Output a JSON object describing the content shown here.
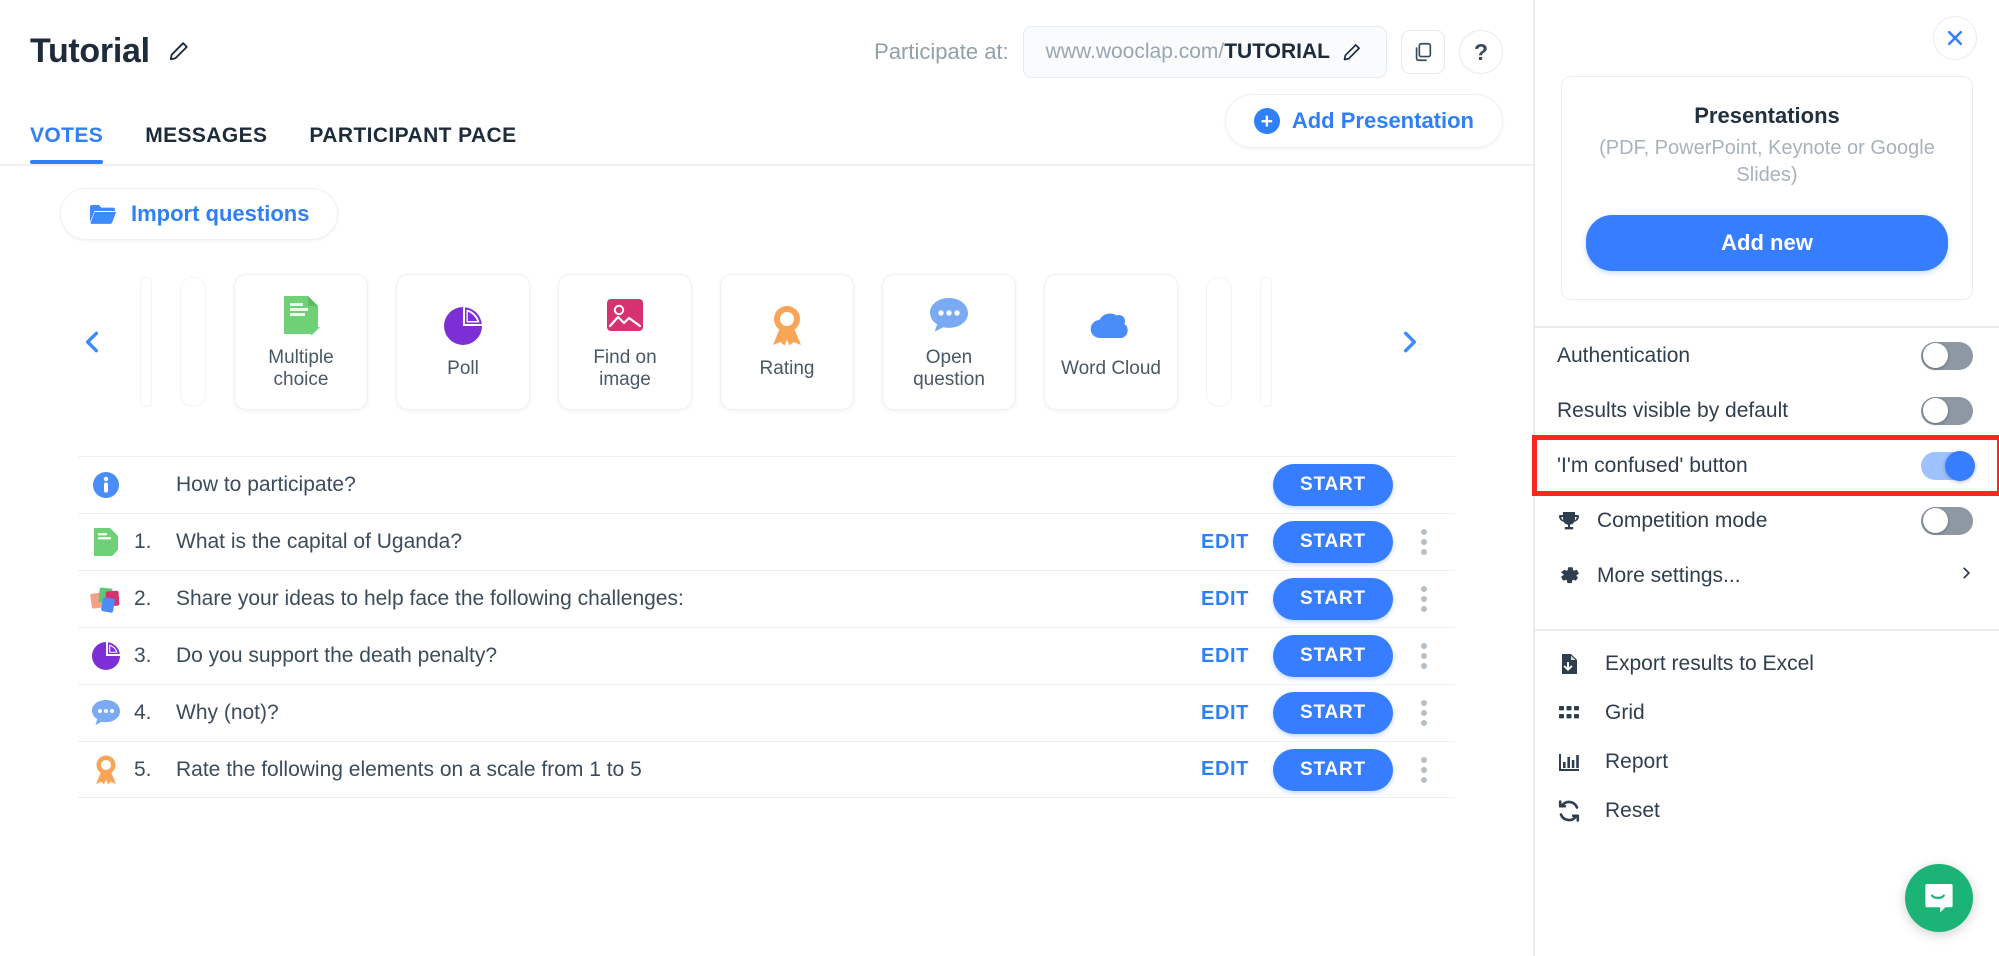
{
  "header": {
    "project_title": "Tutorial",
    "edit_title_icon": "pencil-icon",
    "participate_label": "Participate at:",
    "url_prefix": "www.wooclap.com/",
    "url_code": "TUTORIAL",
    "copy_icon": "copy-icon",
    "help_label": "?",
    "tabs": [
      {
        "label": "VOTES",
        "active": true
      },
      {
        "label": "MESSAGES",
        "active": false
      },
      {
        "label": "PARTICIPANT PACE",
        "active": false
      }
    ],
    "add_presentation_label": "Add Presentation"
  },
  "toolbar": {
    "import_questions_label": "Import questions",
    "prev_arrow_icon": "chevron-left-icon",
    "next_arrow_icon": "chevron-right-icon"
  },
  "question_types": [
    {
      "label": "Multiple choice",
      "icon": "multiple-choice-icon",
      "color": "#6fd176"
    },
    {
      "label": "Poll",
      "icon": "poll-pie-icon",
      "color": "#7b2fd4"
    },
    {
      "label": "Find on image",
      "icon": "find-on-image-icon",
      "color": "#d6326f"
    },
    {
      "label": "Rating",
      "icon": "rating-ribbon-icon",
      "color": "#f6a martin"
    },
    {
      "label": "Open question",
      "icon": "open-question-icon",
      "color": "#6fa8f5"
    },
    {
      "label": "Word Cloud",
      "icon": "word-cloud-icon",
      "color": "#4b8df8"
    }
  ],
  "questions": [
    {
      "num": "",
      "text": "How to participate?",
      "icon": "info-icon",
      "edit": "",
      "start": "START",
      "has_menu": false
    },
    {
      "num": "1.",
      "text": "What is the capital of Uganda?",
      "icon": "multiple-choice-icon",
      "edit": "EDIT",
      "start": "START",
      "has_menu": true
    },
    {
      "num": "2.",
      "text": "Share your ideas to help face the following challenges:",
      "icon": "brainstorm-icon",
      "edit": "EDIT",
      "start": "START",
      "has_menu": true
    },
    {
      "num": "3.",
      "text": "Do you support the death penalty?",
      "icon": "poll-pie-icon",
      "edit": "EDIT",
      "start": "START",
      "has_menu": true
    },
    {
      "num": "4.",
      "text": "Why (not)?",
      "icon": "open-question-icon",
      "edit": "EDIT",
      "start": "START",
      "has_menu": true
    },
    {
      "num": "5.",
      "text": "Rate the following elements on a scale from 1 to 5",
      "icon": "rating-ribbon-icon",
      "edit": "EDIT",
      "start": "START",
      "has_menu": true
    }
  ],
  "sidebar": {
    "close_icon": "close-icon",
    "presentations": {
      "title": "Presentations",
      "subtitle": "(PDF, PowerPoint, Keynote or Google Slides)",
      "add_new_label": "Add new"
    },
    "settings": [
      {
        "label": "Authentication",
        "state": "off",
        "icon": "",
        "highlighted": false
      },
      {
        "label": "Results visible by default",
        "state": "off",
        "icon": "",
        "highlighted": false
      },
      {
        "label": "'I'm confused' button",
        "state": "on",
        "icon": "",
        "highlighted": true
      },
      {
        "label": "Competition mode",
        "state": "off",
        "icon": "trophy-icon",
        "highlighted": false
      },
      {
        "label": "More settings...",
        "state": "chevron",
        "icon": "gear-icon",
        "highlighted": false
      }
    ],
    "menu": [
      {
        "label": "Export results to Excel",
        "icon": "file-download-icon"
      },
      {
        "label": "Grid",
        "icon": "grid-icon"
      },
      {
        "label": "Report",
        "icon": "bar-chart-icon"
      },
      {
        "label": "Reset",
        "icon": "refresh-icon"
      }
    ],
    "chat_icon": "intercom-chat-icon"
  },
  "colors": {
    "accent_blue": "#377dff",
    "highlight_red": "#f8281e",
    "chat_green": "#1bb476"
  }
}
